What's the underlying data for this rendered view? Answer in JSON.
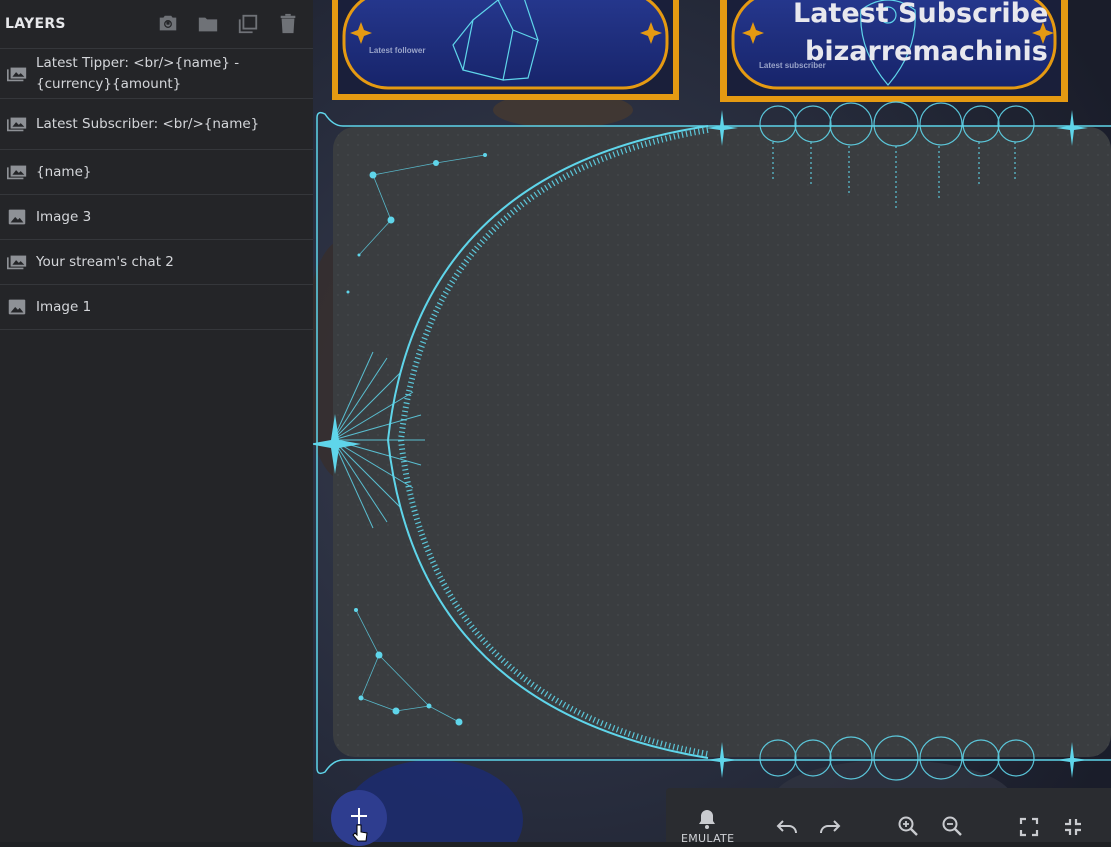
{
  "layers_panel": {
    "title": "LAYERS",
    "header_icons": [
      "add-scene-icon",
      "folder-icon",
      "duplicate-icon",
      "delete-icon"
    ],
    "items": [
      {
        "icon": "image-stack-icon",
        "label": "Latest Tipper: <br/>{name} - {currency}{amount}"
      },
      {
        "icon": "image-stack-icon",
        "label": "Latest Subscriber: <br/>{name}"
      },
      {
        "icon": "image-stack-icon",
        "label": "{name}"
      },
      {
        "icon": "image-icon",
        "label": "Image 3"
      },
      {
        "icon": "image-stack-icon",
        "label": "Your stream's chat 2"
      },
      {
        "icon": "image-icon",
        "label": "Image 1"
      }
    ]
  },
  "canvas": {
    "follower_card_label": "Latest follower",
    "subscriber_card_label": "Latest subscriber",
    "subscriber_title_line1": "Latest Subscribe",
    "subscriber_title_line2": "bizarremachinis",
    "colors": {
      "gold": "#e59a12",
      "navy": "#1f2f7a",
      "cyan": "#5fd5ea",
      "panel_gray": "#3a3d40"
    }
  },
  "toolbar": {
    "add_icon": "plus-icon",
    "emulate_label": "EMULATE",
    "icons": [
      "bell-icon",
      "undo-icon",
      "redo-icon",
      "zoom-in-icon",
      "zoom-out-icon",
      "fullscreen-icon",
      "exit-fullscreen-icon"
    ]
  }
}
